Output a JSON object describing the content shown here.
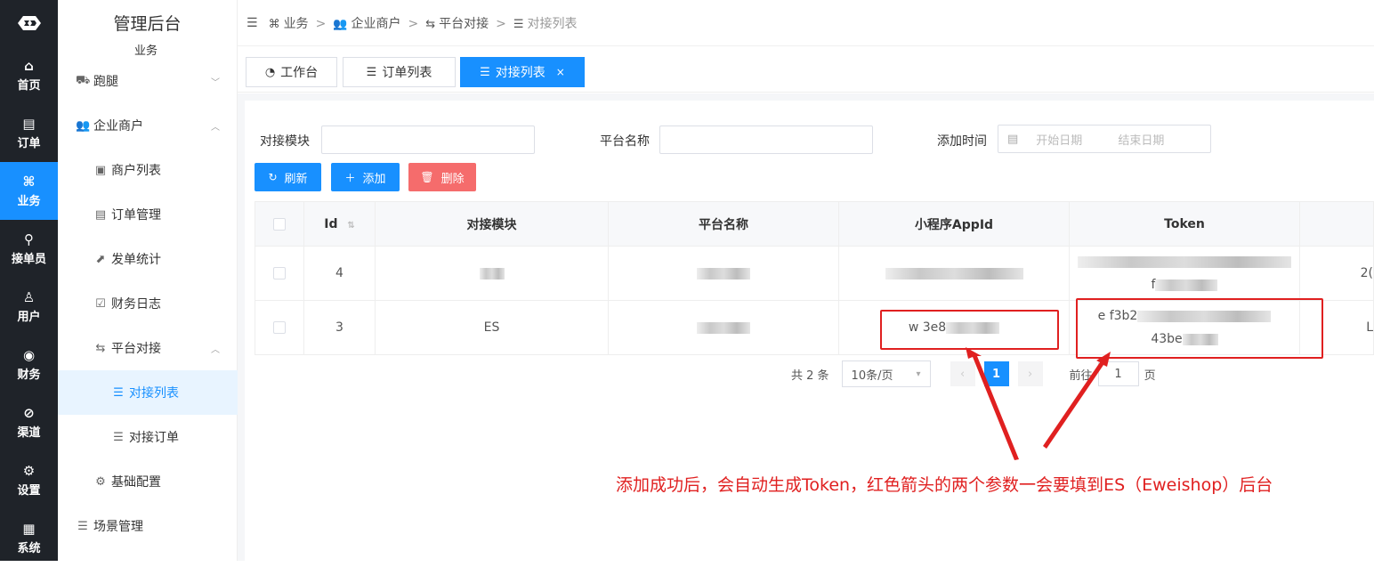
{
  "rail": {
    "items": [
      {
        "label": "首页",
        "icon": "home-icon",
        "glyph": "⌂"
      },
      {
        "label": "订单",
        "icon": "order-icon",
        "glyph": "▤"
      },
      {
        "label": "业务",
        "icon": "command-icon",
        "glyph": "⌘"
      },
      {
        "label": "接单员",
        "icon": "bike-icon",
        "glyph": "⚲"
      },
      {
        "label": "用户",
        "icon": "user-icon",
        "glyph": "♙"
      },
      {
        "label": "财务",
        "icon": "coin-icon",
        "glyph": "◉"
      },
      {
        "label": "渠道",
        "icon": "compass-icon",
        "glyph": "⊘"
      },
      {
        "label": "设置",
        "icon": "settings-icon",
        "glyph": "⚙"
      },
      {
        "label": "系统",
        "icon": "system-icon",
        "glyph": "▦"
      }
    ]
  },
  "menu": {
    "title": "管理后台",
    "subtitle": "业务",
    "items": [
      {
        "label": "跑腿",
        "icon": "errand-icon",
        "glyph": "⛟"
      },
      {
        "label": "企业商户",
        "icon": "users-icon",
        "glyph": "👥"
      },
      {
        "label": "商户列表",
        "icon": "id-card-icon",
        "glyph": "▣"
      },
      {
        "label": "订单管理",
        "icon": "document-icon",
        "glyph": "▤"
      },
      {
        "label": "发单统计",
        "icon": "chart-icon",
        "glyph": "⬈"
      },
      {
        "label": "财务日志",
        "icon": "log-icon",
        "glyph": "☑"
      },
      {
        "label": "平台对接",
        "icon": "swap-icon",
        "glyph": "⇆"
      },
      {
        "label": "对接列表",
        "icon": "list-icon",
        "glyph": "☰"
      },
      {
        "label": "对接订单",
        "icon": "lines-icon",
        "glyph": "☰"
      },
      {
        "label": "基础配置",
        "icon": "gear-icon",
        "glyph": "⚙"
      },
      {
        "label": "场景管理",
        "icon": "lines-icon",
        "glyph": "☰"
      }
    ]
  },
  "breadcrumb": {
    "items": [
      {
        "label": "业务",
        "glyph": "⌘"
      },
      {
        "label": "企业商户",
        "glyph": "👥"
      },
      {
        "label": "平台对接",
        "glyph": "⇆"
      },
      {
        "label": "对接列表",
        "glyph": "☰"
      }
    ]
  },
  "tabs": [
    {
      "label": "工作台",
      "glyph": "◔"
    },
    {
      "label": "订单列表",
      "glyph": "☰"
    },
    {
      "label": "对接列表",
      "glyph": "☰",
      "close": "×"
    }
  ],
  "filters": {
    "module_label": "对接模块",
    "platform_label": "平台名称",
    "time_label": "添加时间",
    "start_placeholder": "开始日期",
    "end_placeholder": "结束日期"
  },
  "buttons": {
    "refresh": "刷新",
    "add": "添加",
    "delete": "删除"
  },
  "table": {
    "headers": [
      "Id",
      "对接模块",
      "平台名称",
      "小程序AppId",
      "Token"
    ],
    "rows": [
      {
        "id": "4",
        "module": "",
        "platform": "",
        "appid": "",
        "token_a": "",
        "token_b": "f",
        "extra": "2("
      },
      {
        "id": "3",
        "module": "ES",
        "platform": "",
        "appid": "w 3e8",
        "token_a": "e f3b2",
        "token_b": "43be",
        "extra": "L"
      }
    ]
  },
  "pagination": {
    "total": "共 2 条",
    "size": "10条/页",
    "page": "1",
    "goto_prefix": "前往",
    "goto_value": "1",
    "goto_suffix": "页"
  },
  "annotation": {
    "text": "添加成功后，会自动生成Token，红色箭头的两个参数一会要填到ES（Eweishop）后台",
    "color": "#e02020"
  },
  "colors": {
    "primary": "#1890ff",
    "danger": "#f56c6c",
    "rail": "#1f2329"
  }
}
